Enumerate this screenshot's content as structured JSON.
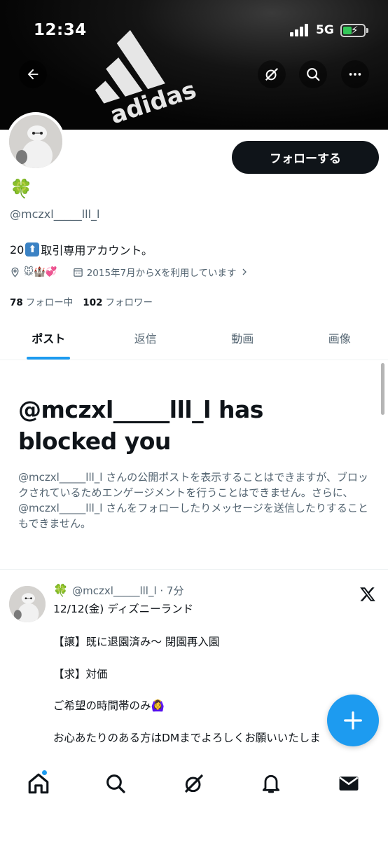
{
  "status_bar": {
    "time": "12:34",
    "network": "5G",
    "battery_state": "charging"
  },
  "header": {
    "back_icon": "arrow-left-icon",
    "actions": [
      "grok-icon",
      "search-icon",
      "more-icon"
    ]
  },
  "banner": {
    "brand_text": "adidas"
  },
  "profile": {
    "display_name": "🍀",
    "handle": "@mczxl_____lll_l",
    "bio_prefix": "20",
    "bio_suffix": "取引専用アカウント。",
    "location": "🐭🏰💞",
    "joined": "2015年7月からXを利用しています",
    "following_count": "78",
    "following_label": "フォロー中",
    "followers_count": "102",
    "followers_label": "フォロワー",
    "follow_button": "フォローする"
  },
  "tabs": [
    {
      "label": "ポスト",
      "active": true
    },
    {
      "label": "返信",
      "active": false
    },
    {
      "label": "動画",
      "active": false
    },
    {
      "label": "画像",
      "active": false
    }
  ],
  "blocked": {
    "title": "@mczxl_____lll_l has blocked you",
    "description": "@mczxl_____lll_l さんの公開ポストを表示することはできますが、ブロックされているためエンゲージメントを行うことはできません。さらに、@mczxl_____lll_l さんをフォローしたりメッセージを送信したりすることもできません。"
  },
  "post": {
    "author_emoji": "🍀",
    "handle_time": "@mczxl_____lll_l · 7分",
    "lines": [
      "12/12(金) ディズニーランド",
      "【譲】既に退園済み〜 閉園再入園",
      "【求】対価",
      "ご希望の時間帯のみ🙆‍♀️",
      "お心あたりのある方はDMまでよろしくお願いいたしま"
    ]
  },
  "fab": {
    "icon": "plus-icon"
  },
  "bottom_nav": [
    {
      "name": "home",
      "icon": "home-icon",
      "has_badge": true
    },
    {
      "name": "search",
      "icon": "search-icon"
    },
    {
      "name": "grok",
      "icon": "grok-icon"
    },
    {
      "name": "notifications",
      "icon": "bell-icon"
    },
    {
      "name": "messages",
      "icon": "mail-icon"
    }
  ],
  "colors": {
    "accent": "#1d9bf0",
    "text_primary": "#0f1419",
    "text_secondary": "#536471"
  }
}
